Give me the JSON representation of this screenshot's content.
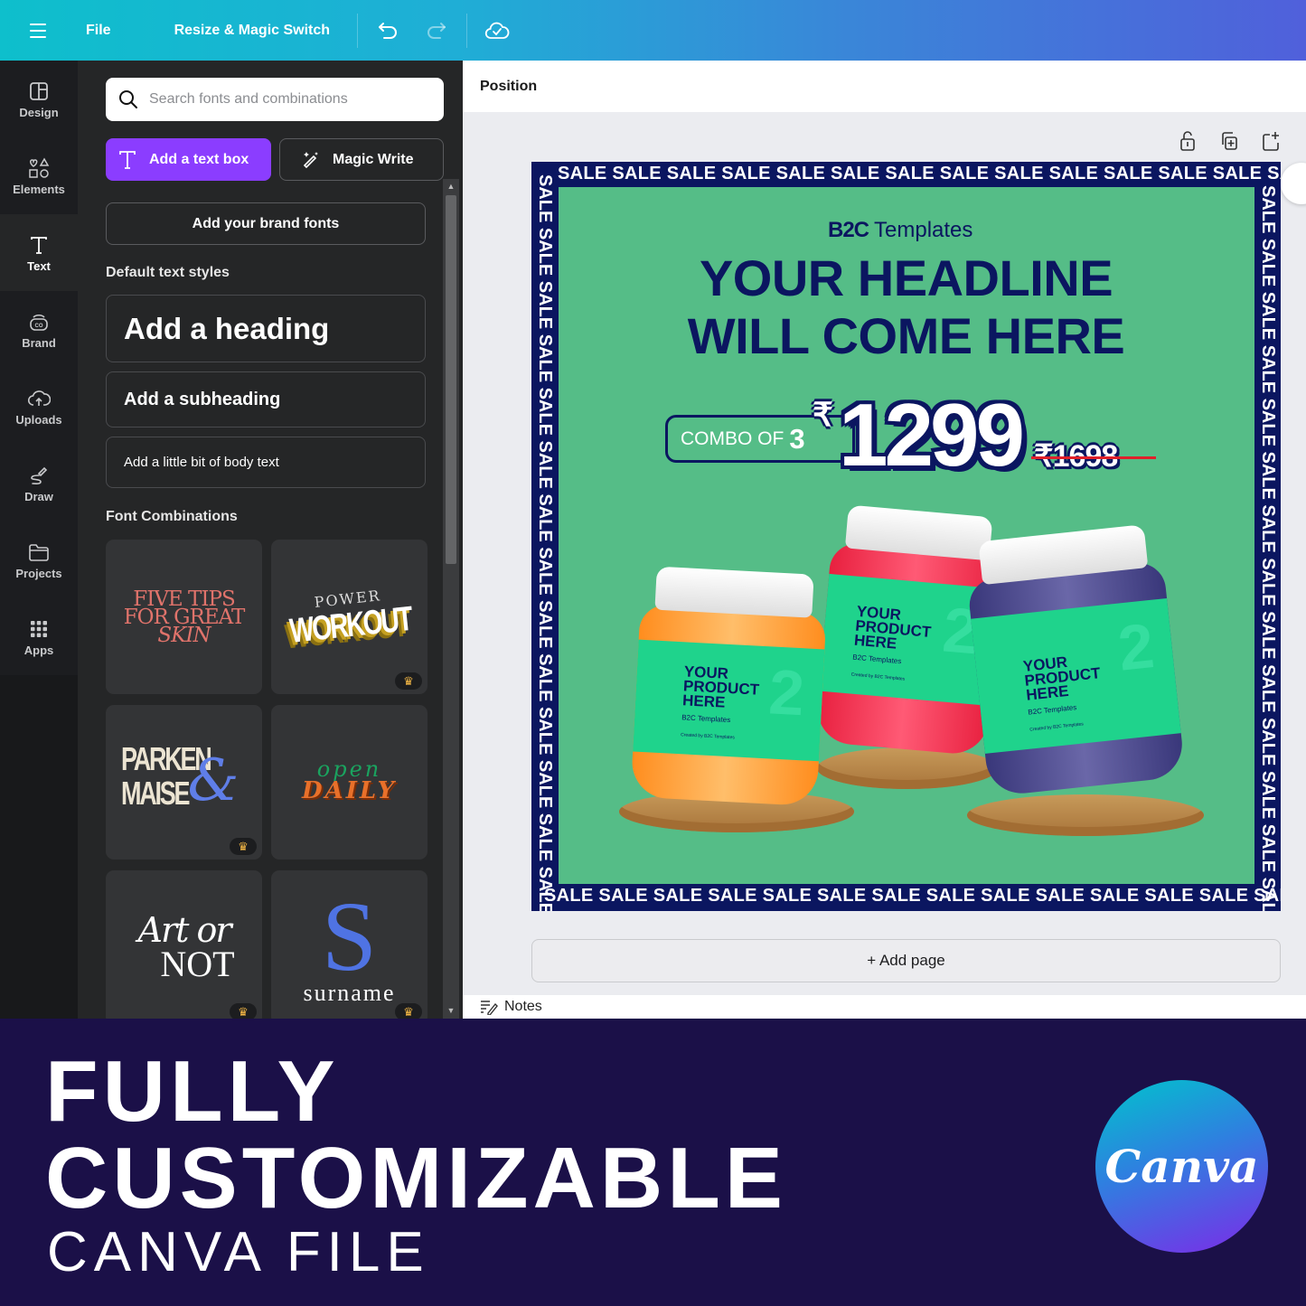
{
  "topbar": {
    "file_label": "File",
    "resize_label": "Resize & Magic Switch",
    "icons": [
      "menu-icon",
      "undo-icon",
      "redo-icon",
      "cloud-saved-icon"
    ]
  },
  "left_rail": {
    "items": [
      {
        "label": "Design",
        "icon": "layout-icon",
        "active": false
      },
      {
        "label": "Elements",
        "icon": "shapes-icon",
        "active": false
      },
      {
        "label": "Text",
        "icon": "text-icon",
        "active": true
      },
      {
        "label": "Brand",
        "icon": "brand-icon",
        "active": false
      },
      {
        "label": "Uploads",
        "icon": "cloud-upload-icon",
        "active": false
      },
      {
        "label": "Draw",
        "icon": "draw-icon",
        "active": false
      },
      {
        "label": "Projects",
        "icon": "folder-icon",
        "active": false
      },
      {
        "label": "Apps",
        "icon": "apps-grid-icon",
        "active": false
      }
    ]
  },
  "text_panel": {
    "search_placeholder": "Search fonts and combinations",
    "search_value": "",
    "add_text_box_label": "Add a text box",
    "magic_write_label": "Magic Write",
    "brand_fonts_label": "Add your brand fonts",
    "default_styles_title": "Default text styles",
    "heading_label": "Add a heading",
    "subheading_label": "Add a subheading",
    "body_label": "Add a little bit of body text",
    "font_combinations_title": "Font Combinations",
    "combinations": [
      {
        "lines": [
          "FIVE TIPS",
          "FOR GREAT",
          "SKIN"
        ],
        "premium": false,
        "color": "#e0736b"
      },
      {
        "lines": [
          "POWER",
          "WORKOUT"
        ],
        "premium": true,
        "color": "#ffffff"
      },
      {
        "lines": [
          "PARKEN",
          "MAISE",
          "&"
        ],
        "premium": true,
        "color": "#ece4d2"
      },
      {
        "lines": [
          "open",
          "DAILY"
        ],
        "premium": false,
        "color": "#e8702a"
      },
      {
        "lines": [
          "Art or",
          "NOT"
        ],
        "premium": true,
        "color": "#ffffff"
      },
      {
        "lines": [
          "S",
          "surname"
        ],
        "premium": true,
        "color": "#4f73e3"
      }
    ]
  },
  "workspace": {
    "context_label": "Position",
    "page_tool_icons": [
      "lock-icon",
      "duplicate-page-icon",
      "add-page-icon"
    ],
    "add_page_label": "+ Add page",
    "notes_label": "Notes"
  },
  "design": {
    "sale_word": "SALE",
    "sale_top": "SALE SALE SALE SALE SALE SALE SALE SALE SALE SALE SALE SALE SALE SALE",
    "sale_bottom": "SALE SALE SALE SALE SALE SALE SALE SALE SALE SALE SALE SALE SALE SALE",
    "sale_left": "SALE SALE SALE SALE SALE SALE SALE SALE SALE SALE SALE SALE SALE SALE",
    "sale_right": "SALE SALE SALE SALE SALE SALE SALE SALE SALE SALE SALE SALE SALE SALE",
    "brand_mark": "B2C",
    "brand_name": "Templates",
    "headline_line1": "YOUR HEADLINE",
    "headline_line2": "WILL COME HERE",
    "combo_text": "COMBO OF",
    "combo_count": "3",
    "currency": "₹",
    "price": "1299",
    "old_price": "₹1698",
    "products": [
      {
        "name_lines": "YOUR PRODUCT HERE",
        "logo": "B2C Templates",
        "credit": "Created by B2C Templates",
        "jar_color": "#ffa43a"
      },
      {
        "name_lines": "YOUR PRODUCT HERE",
        "logo": "B2C Templates",
        "credit": "Created by B2C Templates",
        "jar_color": "#ff3a5a"
      },
      {
        "name_lines": "YOUR PRODUCT HERE",
        "logo": "B2C Templates",
        "credit": "Created by B2C Templates",
        "jar_color": "#4d4a8c"
      }
    ],
    "colors": {
      "frame": "#0b1660",
      "background": "#55bd87",
      "label": "#1fd38c"
    }
  },
  "promo": {
    "line1": "FULLY",
    "line2": "CUSTOMIZABLE",
    "line3": "CANVA FILE",
    "logo_text": "Canva"
  }
}
